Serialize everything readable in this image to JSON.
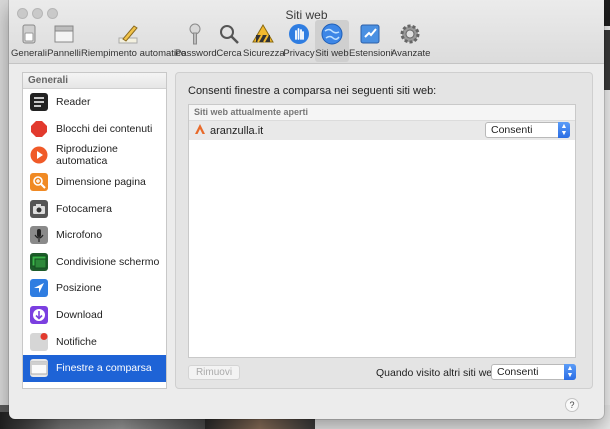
{
  "window": {
    "title": "Siti web"
  },
  "toolbar": {
    "items": [
      {
        "label": "Generali",
        "icon": "toggle-switch-icon"
      },
      {
        "label": "Pannelli",
        "icon": "tabs-window-icon"
      },
      {
        "label": "Riempimento automatico",
        "icon": "pencil-icon"
      },
      {
        "label": "Password",
        "icon": "key-icon"
      },
      {
        "label": "Cerca",
        "icon": "magnifier-icon"
      },
      {
        "label": "Sicurezza",
        "icon": "security-sign-icon"
      },
      {
        "label": "Privacy",
        "icon": "hand-icon"
      },
      {
        "label": "Siti web",
        "icon": "globe-icon",
        "selected": true
      },
      {
        "label": "Estensioni",
        "icon": "puzzle-icon"
      },
      {
        "label": "Avanzate",
        "icon": "gear-icon"
      }
    ]
  },
  "sidebar": {
    "header": "Generali",
    "items": [
      {
        "label": "Reader",
        "icon": "reader-icon",
        "color": "#222222"
      },
      {
        "label": "Blocchi dei contenuti",
        "icon": "stop-sign-icon",
        "color": "#e23a2e"
      },
      {
        "label": "Riproduzione automatica",
        "icon": "play-icon",
        "color": "#f05a28"
      },
      {
        "label": "Dimensione pagina",
        "icon": "zoom-icon",
        "color": "#f08a24"
      },
      {
        "label": "Fotocamera",
        "icon": "camera-icon",
        "color": "#555555"
      },
      {
        "label": "Microfono",
        "icon": "microphone-icon",
        "color": "#8a8a8a"
      },
      {
        "label": "Condivisione schermo",
        "icon": "screen-share-icon",
        "color": "#2e8b3a"
      },
      {
        "label": "Posizione",
        "icon": "location-arrow-icon",
        "color": "#2f7de1"
      },
      {
        "label": "Download",
        "icon": "download-icon",
        "color": "#7b3fe0"
      },
      {
        "label": "Notifiche",
        "icon": "notifications-icon",
        "color": "#d0d0d0"
      },
      {
        "label": "Finestre a comparsa",
        "icon": "popup-windows-icon",
        "color": "#e8e8e8",
        "selected": true
      }
    ]
  },
  "main": {
    "title": "Consenti finestre a comparsa nei seguenti siti web:",
    "list_header": "Siti web attualmente aperti",
    "sites": [
      {
        "name": "aranzulla.it",
        "setting": "Consenti"
      }
    ],
    "remove_button": "Rimuovi",
    "other_sites_label": "Quando visito altri siti web:",
    "other_sites_value": "Consenti"
  },
  "help": {
    "label": "?"
  },
  "colors": {
    "selection": "#1e63d6",
    "popup_arrows": "#2a6de4"
  }
}
